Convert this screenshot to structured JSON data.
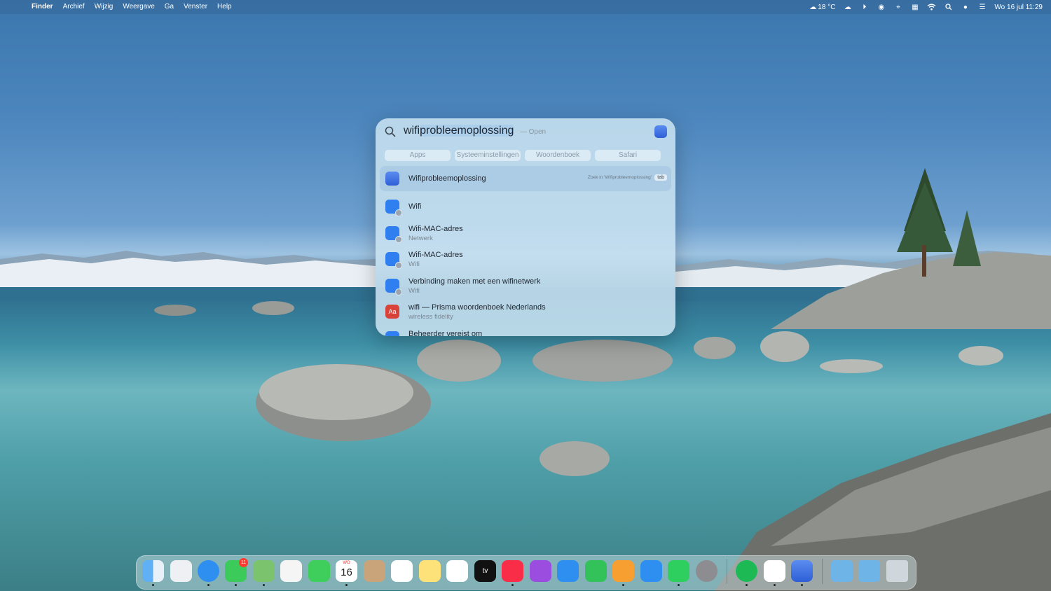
{
  "menubar": {
    "apple_glyph": "",
    "app_name": "Finder",
    "menus": [
      "Archief",
      "Wijzig",
      "Weergave",
      "Ga",
      "Venster",
      "Help"
    ],
    "weather": "18 °C",
    "datetime": "Wo 16 jul  11:29"
  },
  "spotlight": {
    "query_typed": "wifi",
    "query_completion": "probleemoplossing",
    "query_hint": "— Open",
    "tabs": [
      "Apps",
      "Systeeminstellingen",
      "Woordenboek",
      "Safari"
    ],
    "top_hit": {
      "title": "Wifiprobleemoplossing",
      "hint": "Zoek in 'Wifiprobleemoplossing'",
      "key": "tab"
    },
    "results": [
      {
        "title": "Wifi",
        "subtitle": ""
      },
      {
        "title": "Wifi-MAC-adres",
        "subtitle": "Netwerk"
      },
      {
        "title": "Wifi-MAC-adres",
        "subtitle": "Wifi"
      },
      {
        "title": "Verbinding maken met een wifinetwerk",
        "subtitle": "Wifi"
      },
      {
        "title": "wifi — Prisma woordenboek Nederlands",
        "subtitle": "wireless fidelity"
      },
      {
        "title": "Beheerder vereist om",
        "subtitle": ""
      }
    ],
    "dictionary_icon_text": "Aa"
  },
  "dock": {
    "apps": [
      "Finder",
      "Launchpad",
      "Safari",
      "Berichten",
      "Kaarten",
      "Foto's",
      "FaceTime",
      "Agenda",
      "Contacten",
      "Herinneringen",
      "Notities",
      "Freeform",
      "TV",
      "Muziek",
      "Podcasts",
      "Keynote",
      "Numbers",
      "Pages",
      "App Store",
      "WhatsApp",
      "Systeeminstellingen",
      "Spotify",
      "Slack",
      "Wifiprobleemoplossing",
      "Downloads",
      "Programma's",
      "Prullenmand"
    ],
    "messages_badge": "11",
    "calendar_day": "16",
    "calendar_month": "WO",
    "tv_label": "tv"
  },
  "colors": {
    "spotlight_bg": "#c8e1f0",
    "accent_blue": "#2f6fe0",
    "badge_red": "#ff3b30"
  }
}
